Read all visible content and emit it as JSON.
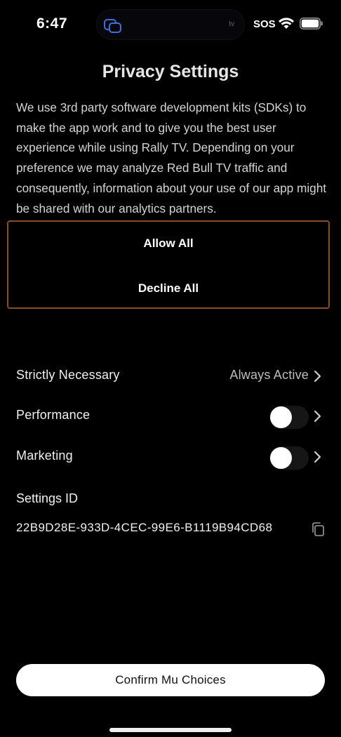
{
  "status_bar": {
    "time": "6:47",
    "tv_label": "tv",
    "sos": "SOS"
  },
  "title": "Privacy Settings",
  "description": "We use 3rd party software development kits (SDKs) to make the app work and to give you the best user experience while using Rally TV. Depending on your preference we may analyze Red Bull TV traffic and consequently, information about your use of our app might be shared with our analytics partners.",
  "buttons": {
    "allow_all": "Allow All",
    "decline_all": "Decline All",
    "confirm": "Confirm Mu Choices"
  },
  "categories": [
    {
      "label": "Strictly Necessary",
      "status": "Always Active"
    },
    {
      "label": "Performance",
      "enabled": false
    },
    {
      "label": "Marketing",
      "enabled": false
    }
  ],
  "settings_id": {
    "label": "Settings ID",
    "value": "22B9D28E-933D-4CEC-99E6-B1119B94CD68"
  },
  "colors": {
    "background": "#000000",
    "accent_border": "#8b4c1f",
    "confirm_bg": "#ffffff"
  }
}
